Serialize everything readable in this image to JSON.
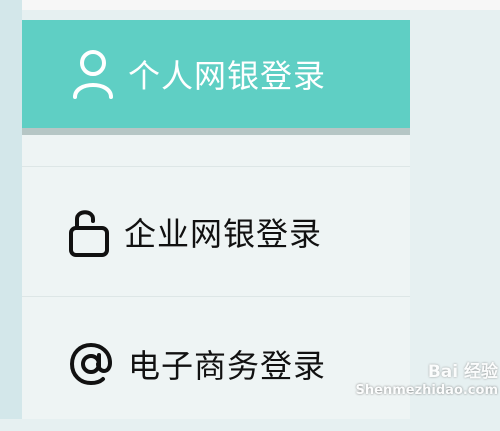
{
  "menu": {
    "items": [
      {
        "label": "个人网银登录",
        "icon": "user-icon",
        "active": true
      },
      {
        "label": "企业网银登录",
        "icon": "unlock-icon",
        "active": false
      },
      {
        "label": "电子商务登录",
        "icon": "at-sign-icon",
        "active": false
      }
    ]
  },
  "watermark": {
    "brand": "Bai 经验",
    "url": "Shenmezhidao.com"
  },
  "colors": {
    "active_bg": "#5fcfc4",
    "panel_bg": "#eef4f4",
    "page_bg": "#e6f0f1"
  }
}
